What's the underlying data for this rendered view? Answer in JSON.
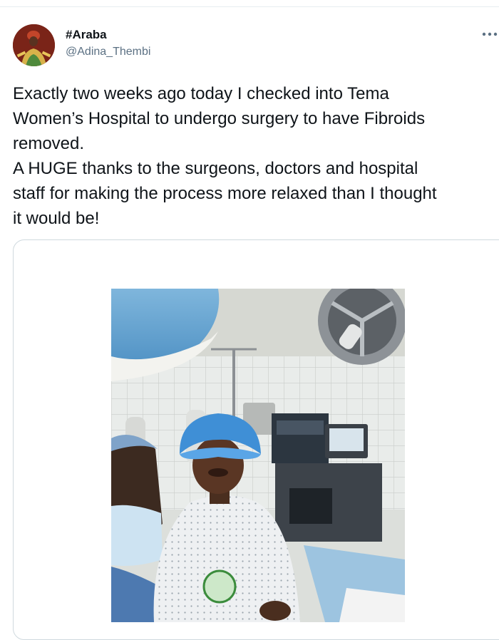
{
  "tweet": {
    "display_name": "#Araba",
    "handle": "@Adina_Thembi",
    "text_lines": [
      "Exactly two weeks ago today I checked into Tema",
      "Women’s Hospital to undergo surgery to have Fibroids",
      "removed.",
      "A HUGE thanks to the surgeons, doctors and hospital",
      "staff for making the process more relaxed than I thought",
      "it would be!"
    ],
    "more_icon": "more-horizontal-icon"
  },
  "media": {
    "type": "photo",
    "icon": "hospital-operating-room-photo"
  },
  "colors": {
    "text_primary": "#0f1419",
    "text_secondary": "#5b7083",
    "border": "#cfd9de"
  }
}
